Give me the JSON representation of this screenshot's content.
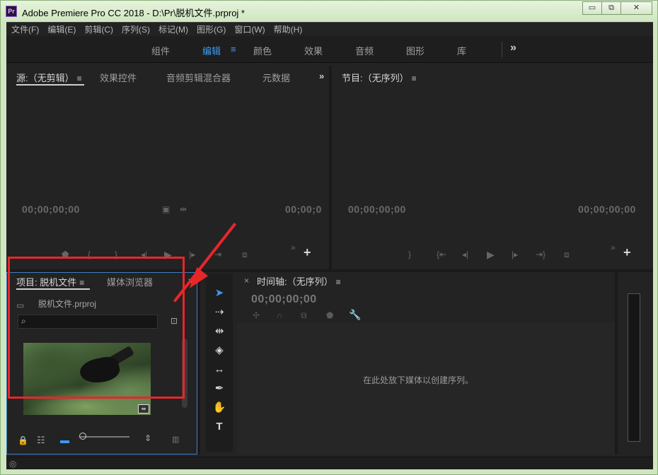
{
  "window": {
    "app_icon": "Pr",
    "title": "Adobe Premiere Pro CC 2018 - D:\\Pr\\脱机文件.prproj *",
    "minimize": "▭",
    "restore": "⧉",
    "close": "✕"
  },
  "menubar": [
    "文件(F)",
    "编辑(E)",
    "剪辑(C)",
    "序列(S)",
    "标记(M)",
    "图形(G)",
    "窗口(W)",
    "帮助(H)"
  ],
  "workspaces": {
    "tabs": [
      "组件",
      "编辑",
      "颜色",
      "效果",
      "音频",
      "图形",
      "库"
    ],
    "active": "编辑",
    "menu_glyph": "≡",
    "more": "»"
  },
  "source_panel": {
    "tabs": [
      "源:（无剪辑）",
      "效果控件",
      "音频剪辑混合器",
      "元数据"
    ],
    "menu_glyph": "≡",
    "more": "»",
    "timecode_left": "00;00;00;00",
    "timecode_right": "00;00;0"
  },
  "program_panel": {
    "title": "节目:（无序列）",
    "menu_glyph": "≡",
    "timecode_left": "00;00;00;00",
    "timecode_right": "00;00;00;00"
  },
  "project_panel": {
    "tabs": [
      "项目: 脱机文件",
      "媒体浏览器"
    ],
    "menu_glyph": "≡",
    "more": "»",
    "file_name": "脱机文件.prproj"
  },
  "timeline_panel": {
    "close": "×",
    "title": "时间轴:（无序列）",
    "menu_glyph": "≡",
    "timecode": "00;00;00;00",
    "drop_text": "在此处放下媒体以创建序列。"
  },
  "tools": [
    "selection-tool-icon",
    "track-select-tool-icon",
    "ripple-edit-tool-icon",
    "razor-tool-icon",
    "slip-tool-icon",
    "pen-tool-icon",
    "hand-tool-icon",
    "type-tool-icon"
  ],
  "colors": {
    "accent": "#3d9bf3",
    "annotation": "#e8262a",
    "panel_bg": "#232323"
  }
}
